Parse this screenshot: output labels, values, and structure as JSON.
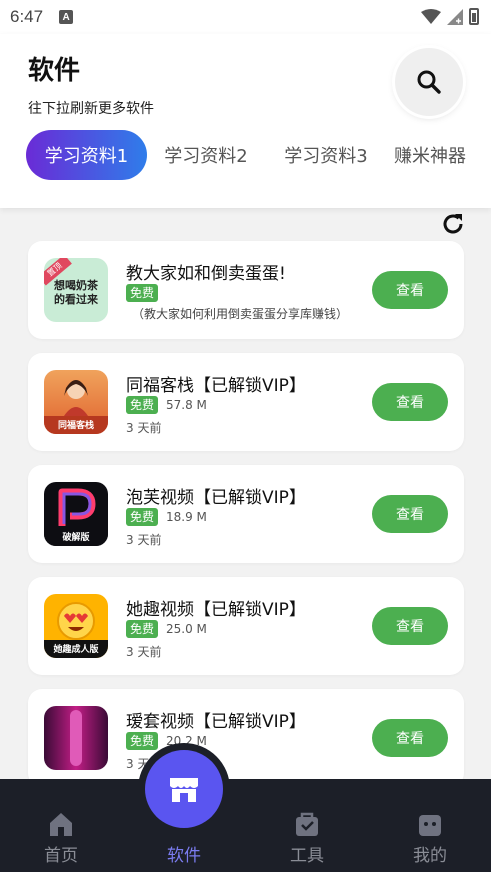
{
  "status_bar": {
    "time": "6:47",
    "notify_icon": "A"
  },
  "header": {
    "title": "软件",
    "subtitle": "往下拉刷新更多软件",
    "tabs": [
      {
        "label": "学习资料1",
        "active": true
      },
      {
        "label": "学习资料2",
        "active": false
      },
      {
        "label": "学习资料3",
        "active": false
      },
      {
        "label": "赚米神器",
        "active": false
      }
    ]
  },
  "apps": [
    {
      "name": "教大家如和倒卖蛋蛋!",
      "badge": "免费",
      "size": "",
      "desc": "（教大家如何利用倒卖蛋蛋分享库赚钱）",
      "time": "",
      "button": "查看",
      "icon": "milk-tea-icon",
      "icon_text": "想喝奶茶的看过来",
      "icon_tag": "置顶"
    },
    {
      "name": "同福客栈【已解锁VIP】",
      "badge": "免费",
      "size": "57.8 M",
      "desc": "",
      "time": "3 天前",
      "button": "查看",
      "icon": "tongfu-inn-icon",
      "icon_text": "同福客栈"
    },
    {
      "name": "泡芙视频【已解锁VIP】",
      "badge": "免费",
      "size": "18.9 M",
      "desc": "",
      "time": "3 天前",
      "button": "查看",
      "icon": "paofu-video-icon",
      "icon_text": "破解版"
    },
    {
      "name": "她趣视频【已解锁VIP】",
      "badge": "免费",
      "size": "25.0 M",
      "desc": "",
      "time": "3 天前",
      "button": "查看",
      "icon": "taqu-video-icon",
      "icon_text": "她趣成人版"
    },
    {
      "name": "瑷套视频【已解锁VIP】",
      "badge": "免费",
      "size": "20.2 M",
      "desc": "",
      "time": "3 天前",
      "button": "查看",
      "icon": "aitao-video-icon",
      "icon_text": ""
    }
  ],
  "bottom_nav": [
    {
      "label": "首页",
      "icon": "home-icon",
      "active": false
    },
    {
      "label": "软件",
      "icon": "store-icon",
      "active": true
    },
    {
      "label": "工具",
      "icon": "toolbox-icon",
      "active": false
    },
    {
      "label": "我的",
      "icon": "profile-icon",
      "active": false
    }
  ],
  "colors": {
    "accent_green": "#4caf50",
    "tab_gradient_start": "#6a2bd6",
    "tab_gradient_end": "#2f7dea",
    "nav_bg": "#1c1f28",
    "nav_active": "#7b7cf0",
    "fab": "#5a55f0"
  }
}
